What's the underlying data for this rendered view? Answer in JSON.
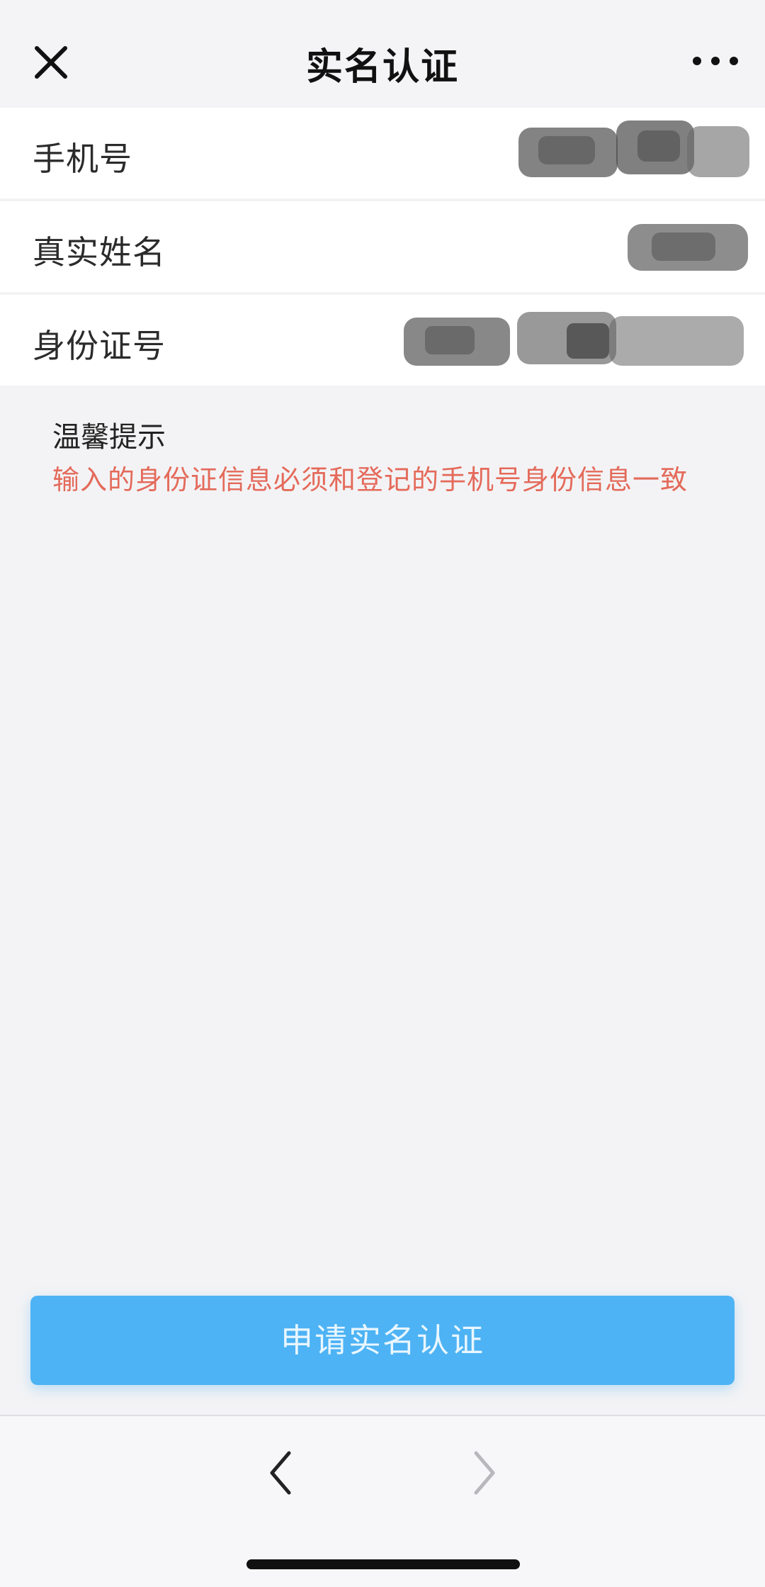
{
  "header": {
    "title": "实名认证",
    "close_icon": "close-icon",
    "more_icon": "more-horizontal-icon"
  },
  "form": {
    "rows": [
      {
        "label": "手机号"
      },
      {
        "label": "真实姓名"
      },
      {
        "label": "身份证号"
      }
    ]
  },
  "tips": {
    "title": "温馨提示",
    "text": "输入的身份证信息必须和登记的手机号身份信息一致"
  },
  "submit": {
    "label": "申请实名认证"
  },
  "bottom_nav": {
    "back_icon": "chevron-left-icon",
    "forward_icon": "chevron-right-icon"
  },
  "colors": {
    "accent": "#4db3f4",
    "warning_text": "#e46a5a",
    "background": "#f3f3f5"
  }
}
